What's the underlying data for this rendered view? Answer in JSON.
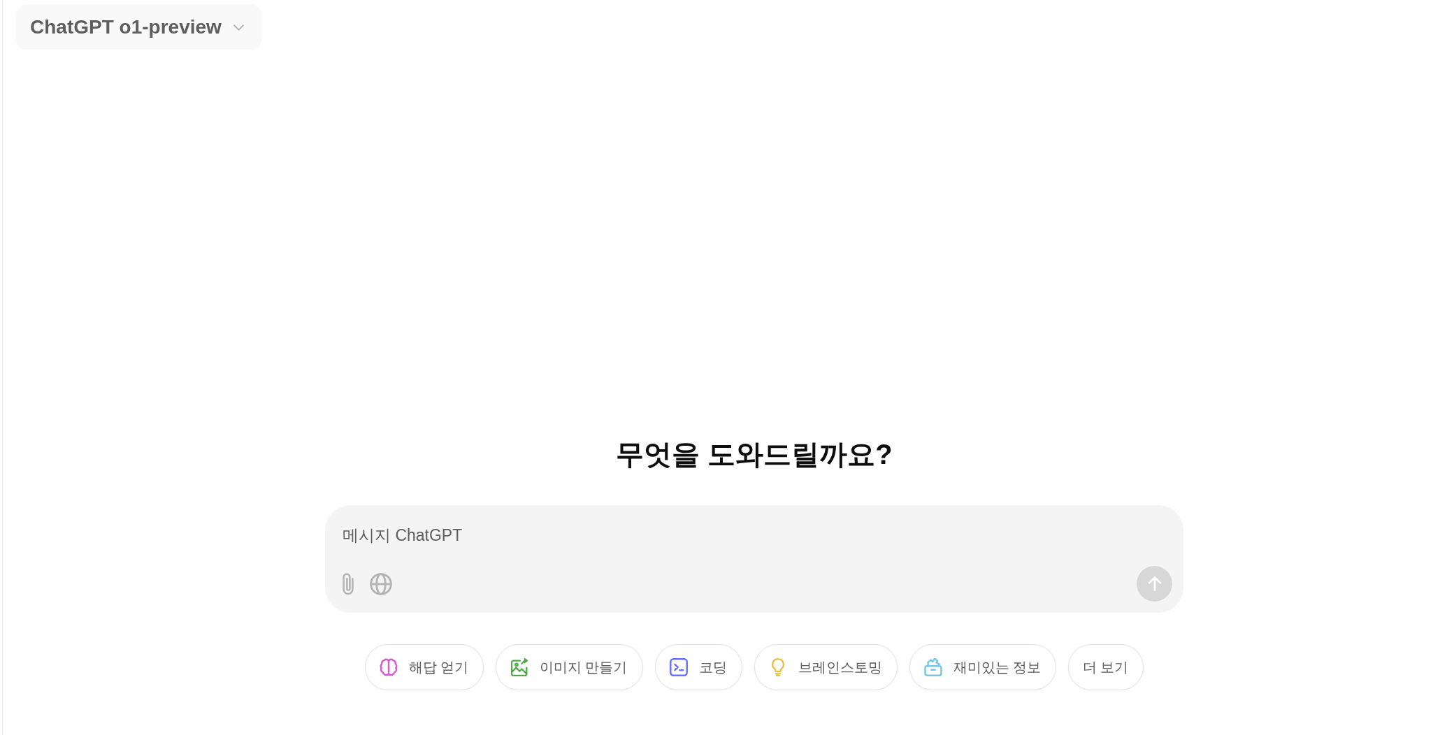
{
  "model_selector": {
    "label": "ChatGPT o1-preview"
  },
  "heading": "무엇을 도와드릴까요?",
  "composer": {
    "placeholder": "메시지 ChatGPT",
    "send_button": {
      "disabled": true
    }
  },
  "suggestions": [
    {
      "kind": "brain",
      "label": "해답 얻기",
      "color": "#d65ccc"
    },
    {
      "kind": "image",
      "label": "이미지 만들기",
      "color": "#52a94b"
    },
    {
      "kind": "code",
      "label": "코딩",
      "color": "#6c71ff"
    },
    {
      "kind": "bulb",
      "label": "브레인스토밍",
      "color": "#e2c13f"
    },
    {
      "kind": "box",
      "label": "재미있는 정보",
      "color": "#76c5e8"
    },
    {
      "kind": "more",
      "label": "더 보기"
    }
  ]
}
